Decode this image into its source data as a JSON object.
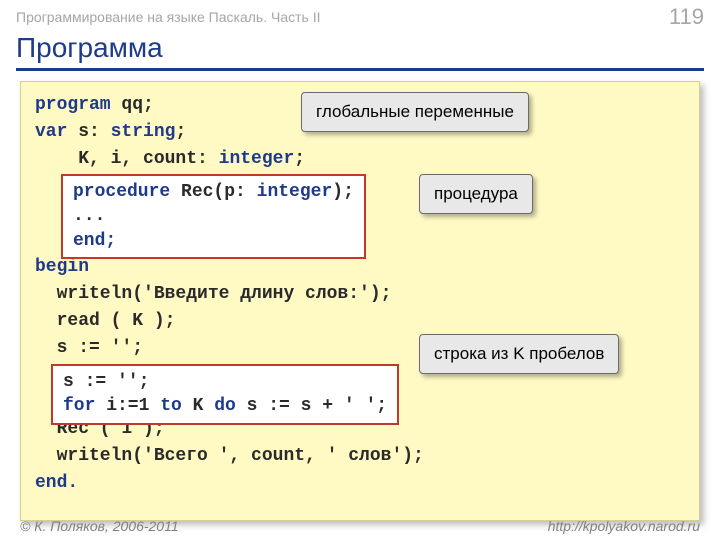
{
  "header": {
    "course": "Программирование на языке Паскаль. Часть II",
    "page": "119"
  },
  "title": "Программа",
  "code": {
    "l1a": "program",
    "l1b": " qq;",
    "l2a": "var",
    "l2b": " s: ",
    "l2c": "string",
    "l2d": ";",
    "l3": "    K, i, count: ",
    "l3b": "integer",
    "l3c": ";",
    "l5": "begin",
    "l6": "  writeln('Введите длину слов:');",
    "l7": "  read ( K );",
    "l8": "  s := '';",
    "l11": "  Rec ( 1 );",
    "l12": "  writeln('Всего ', count, ' слов');",
    "l13": "end."
  },
  "inset1": {
    "a": "procedure",
    "b": " Rec(p: ",
    "c": "integer",
    "d": ");",
    "e": "...",
    "f": "end;"
  },
  "inset2": {
    "a": "s := '';",
    "b1": "for",
    "b2": " i:=1 ",
    "b3": "to",
    "b4": " K ",
    "b5": "do",
    "b6": " s := s + ' ';"
  },
  "callouts": {
    "globals": "глобальные переменные",
    "proc": "процедура",
    "spaces": "строка из K пробелов"
  },
  "footer": {
    "copyright": "© К. Поляков, 2006-2011",
    "url": "http://kpolyakov.narod.ru"
  }
}
